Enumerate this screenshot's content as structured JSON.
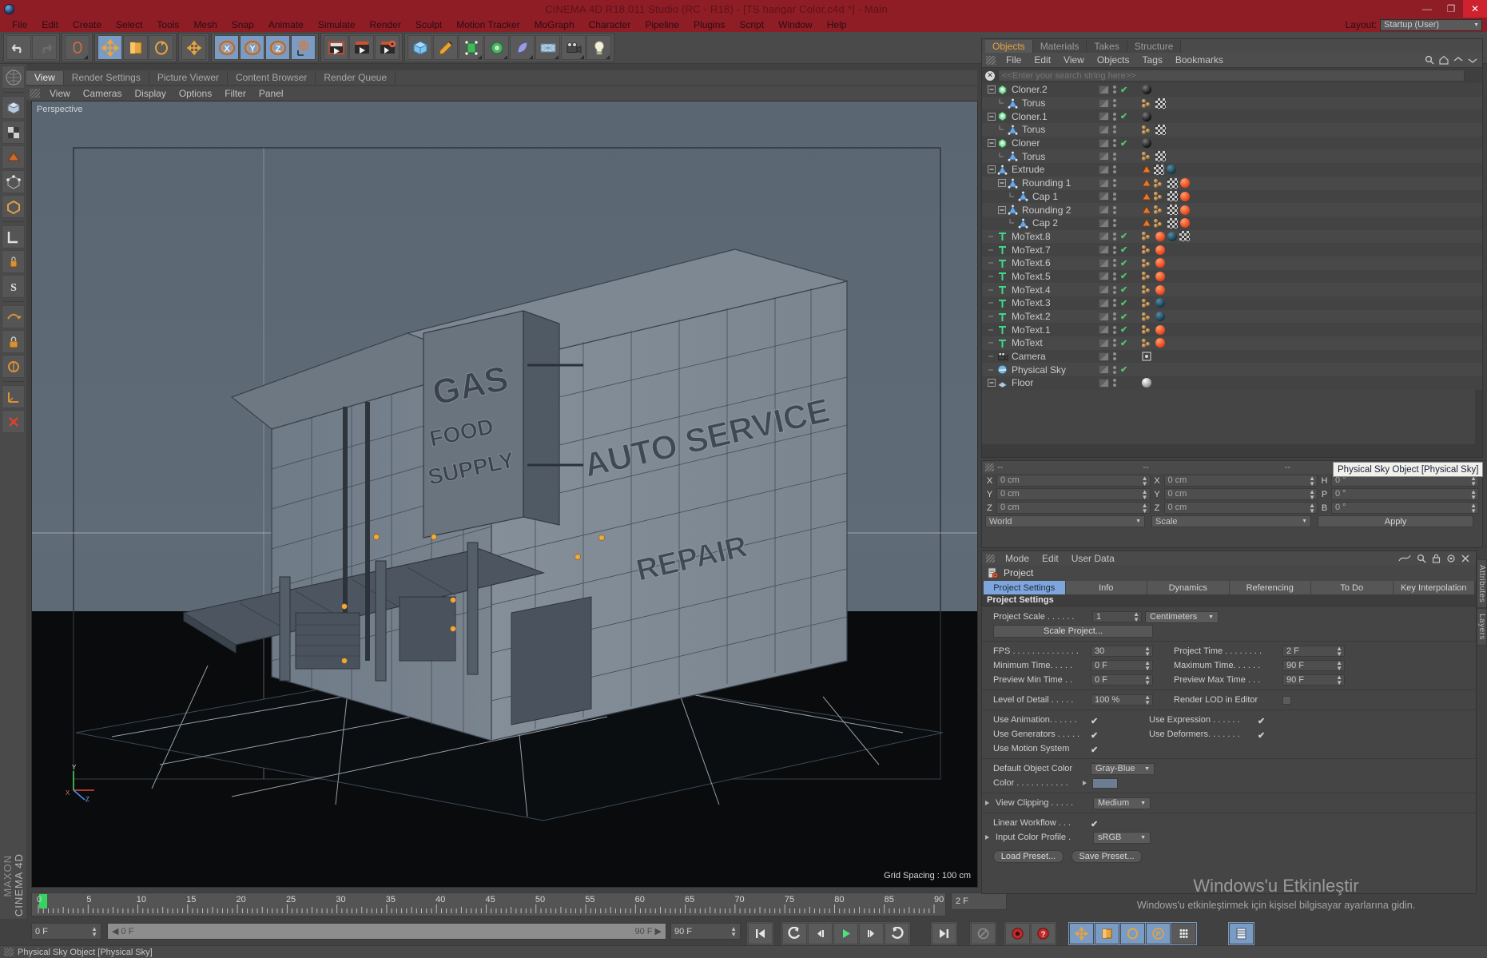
{
  "window": {
    "title": "CINEMA 4D R18.011 Studio (RC - R18) - [TS hangar Color.c4d *] - Main",
    "minimize": "—",
    "maximize": "❐",
    "close": "✕"
  },
  "menubar": {
    "items": [
      "File",
      "Edit",
      "Create",
      "Select",
      "Tools",
      "Mesh",
      "Snap",
      "Animate",
      "Simulate",
      "Render",
      "Sculpt",
      "Motion Tracker",
      "MoGraph",
      "Character",
      "Pipeline",
      "Plugins",
      "Script",
      "Window",
      "Help"
    ],
    "layout_label": "Layout:",
    "layout_value": "Startup (User)"
  },
  "viewport": {
    "tabs": [
      "View",
      "Render Settings",
      "Picture Viewer",
      "Content Browser",
      "Render Queue"
    ],
    "active_tab": "View",
    "menus": [
      "View",
      "Cameras",
      "Display",
      "Options",
      "Filter",
      "Panel"
    ],
    "perspective_label": "Perspective",
    "grid_spacing": "Grid Spacing : 100 cm",
    "signage": [
      "GAS",
      "FOOD SUPPLY",
      "AUTO SERVICE",
      "REPAIR"
    ],
    "axis": {
      "x": "X",
      "y": "Y",
      "z": "Z"
    }
  },
  "object_manager": {
    "tabs": [
      "Objects",
      "Materials",
      "Takes",
      "Structure"
    ],
    "active_tab": "Objects",
    "menus": [
      "File",
      "Edit",
      "View",
      "Objects",
      "Tags",
      "Bookmarks"
    ],
    "search_placeholder": "<<Enter your search string here>>",
    "rows": [
      {
        "name": "Cloner.2",
        "icon": "cloner-icon",
        "depth": 0,
        "expander": "minus",
        "check": true,
        "mat": [
          "sph-k"
        ]
      },
      {
        "name": "Torus",
        "icon": "torus-icon",
        "depth": 1,
        "expander": "none",
        "check": false,
        "mat": [
          "dotpair",
          "checker"
        ]
      },
      {
        "name": "Cloner.1",
        "icon": "cloner-icon",
        "depth": 0,
        "expander": "minus",
        "check": true,
        "mat": [
          "sph-k"
        ]
      },
      {
        "name": "Torus",
        "icon": "torus-icon",
        "depth": 1,
        "expander": "none",
        "check": false,
        "mat": [
          "dotpair",
          "checker"
        ]
      },
      {
        "name": "Cloner",
        "icon": "cloner-icon",
        "depth": 0,
        "expander": "minus",
        "check": true,
        "mat": [
          "sph-k"
        ]
      },
      {
        "name": "Torus",
        "icon": "torus-icon",
        "depth": 1,
        "expander": "none",
        "check": false,
        "mat": [
          "dotpair",
          "checker"
        ]
      },
      {
        "name": "Extrude",
        "icon": "extrude-icon",
        "depth": 0,
        "expander": "minus",
        "check": false,
        "mat": [
          "tri-o",
          "checker",
          "sph-b"
        ]
      },
      {
        "name": "Rounding 1",
        "icon": "extrude-icon",
        "depth": 1,
        "expander": "minus",
        "check": false,
        "mat": [
          "tri-o",
          "dotpair",
          "checker",
          "sph-o"
        ]
      },
      {
        "name": "Cap 1",
        "icon": "extrude-icon",
        "depth": 2,
        "expander": "none",
        "check": false,
        "mat": [
          "tri-o",
          "dotpair",
          "checker",
          "sph-o"
        ]
      },
      {
        "name": "Rounding 2",
        "icon": "extrude-icon",
        "depth": 1,
        "expander": "minus",
        "check": false,
        "mat": [
          "tri-o",
          "dotpair",
          "checker",
          "sph-o"
        ]
      },
      {
        "name": "Cap 2",
        "icon": "extrude-icon",
        "depth": 2,
        "expander": "none",
        "check": false,
        "mat": [
          "tri-o",
          "dotpair",
          "checker",
          "sph-o"
        ]
      },
      {
        "name": "MoText.8",
        "icon": "motext-icon",
        "depth": 0,
        "expander": "dash",
        "check": true,
        "mat": [
          "dotpair",
          "sph-o",
          "sph-b",
          "checker"
        ]
      },
      {
        "name": "MoText.7",
        "icon": "motext-icon",
        "depth": 0,
        "expander": "dash",
        "check": true,
        "mat": [
          "dotpair",
          "sph-o"
        ]
      },
      {
        "name": "MoText.6",
        "icon": "motext-icon",
        "depth": 0,
        "expander": "dash",
        "check": true,
        "mat": [
          "dotpair",
          "sph-o"
        ]
      },
      {
        "name": "MoText.5",
        "icon": "motext-icon",
        "depth": 0,
        "expander": "dash",
        "check": true,
        "mat": [
          "dotpair",
          "sph-o"
        ]
      },
      {
        "name": "MoText.4",
        "icon": "motext-icon",
        "depth": 0,
        "expander": "dash",
        "check": true,
        "mat": [
          "dotpair",
          "sph-o"
        ]
      },
      {
        "name": "MoText.3",
        "icon": "motext-icon",
        "depth": 0,
        "expander": "dash",
        "check": true,
        "mat": [
          "dotpair",
          "sph-b"
        ]
      },
      {
        "name": "MoText.2",
        "icon": "motext-icon",
        "depth": 0,
        "expander": "dash",
        "check": true,
        "mat": [
          "dotpair",
          "sph-b"
        ]
      },
      {
        "name": "MoText.1",
        "icon": "motext-icon",
        "depth": 0,
        "expander": "dash",
        "check": true,
        "mat": [
          "dotpair",
          "sph-o"
        ]
      },
      {
        "name": "MoText",
        "icon": "motext-icon",
        "depth": 0,
        "expander": "dash",
        "check": true,
        "mat": [
          "dotpair",
          "sph-o"
        ]
      },
      {
        "name": "Camera",
        "icon": "camera-icon",
        "depth": 0,
        "expander": "dash",
        "check": false,
        "mat": [
          "target"
        ]
      },
      {
        "name": "Physical Sky",
        "icon": "sky-icon",
        "depth": 0,
        "expander": "dash",
        "check": true,
        "mat": []
      },
      {
        "name": "Floor",
        "icon": "floor-icon",
        "depth": 0,
        "expander": "minus",
        "check": false,
        "mat": [
          "sph-w"
        ]
      }
    ]
  },
  "coordinates": {
    "header_left": "--",
    "header_right": "--",
    "position": {
      "x_label": "X",
      "y_label": "Y",
      "z_label": "Z",
      "x": "0 cm",
      "y": "0 cm",
      "z": "0 cm"
    },
    "size": {
      "x_label": "X",
      "y_label": "Y",
      "z_label": "Z",
      "x": "0 cm",
      "y": "0 cm",
      "z": "0 cm"
    },
    "rotation": {
      "h_label": "H",
      "p_label": "P",
      "b_label": "B",
      "h": "0 °",
      "p": "0 °",
      "b": "0 °"
    },
    "coord_system": "World",
    "mode": "Scale",
    "apply_label": "Apply"
  },
  "attributes": {
    "menus": [
      "Mode",
      "Edit",
      "User Data"
    ],
    "object_title": "Project",
    "tabs": [
      "Project Settings",
      "Info",
      "Dynamics",
      "Referencing",
      "To Do",
      "Key Interpolation"
    ],
    "active_tab": "Project Settings",
    "section_title": "Project Settings",
    "fields": {
      "project_scale_label": "Project Scale . . . . . .",
      "project_scale_value": "1",
      "project_scale_unit": "Centimeters",
      "scale_project_btn": "Scale Project...",
      "fps_label": "FPS . . . . . . . . . . . . . .",
      "fps_value": "30",
      "project_time_label": "Project Time . . . . . . . .",
      "project_time_value": "2 F",
      "min_time_label": "Minimum Time. . . . .",
      "min_time_value": "0 F",
      "max_time_label": "Maximum Time. . . . . .",
      "max_time_value": "90 F",
      "prev_min_label": "Preview Min Time . .",
      "prev_min_value": "0 F",
      "prev_max_label": "Preview Max Time . . .",
      "prev_max_value": "90 F",
      "lod_label": "Level of Detail . . . . .",
      "lod_value": "100 %",
      "render_lod_label": "Render LOD in Editor",
      "use_animation_label": "Use Animation. . . . . .",
      "use_expression_label": "Use Expression . . . . . .",
      "use_generators_label": "Use Generators . . . . .",
      "use_deformers_label": "Use Deformers. . . . . . .",
      "use_motion_label": "Use Motion System",
      "default_color_label": "Default Object Color",
      "default_color_value": "Gray-Blue",
      "color_label": "Color . . . . . . . . . . .",
      "color_swatch": "#6c7d92",
      "view_clipping_label": "View Clipping . . . . .",
      "view_clipping_value": "Medium",
      "linear_workflow_label": "Linear Workflow . . .",
      "input_profile_label": "Input Color Profile .",
      "input_profile_value": "sRGB",
      "load_preset_btn": "Load Preset...",
      "save_preset_btn": "Save Preset..."
    }
  },
  "edge_tabs": [
    "Attributes",
    "Layers"
  ],
  "timeline": {
    "ticks": [
      "0",
      "5",
      "10",
      "15",
      "20",
      "25",
      "30",
      "35",
      "40",
      "45",
      "50",
      "55",
      "60",
      "65",
      "70",
      "75",
      "80",
      "85",
      "90"
    ],
    "current_marker": "2",
    "frame_field": "2 F",
    "current_frame": "0 F",
    "range_start": "0 F",
    "range_end": "90 F",
    "end_field": "90 F"
  },
  "statusbar": {
    "text": "Physical Sky Object [Physical Sky]"
  },
  "tooltip": {
    "text": "Physical Sky Object [Physical Sky]"
  },
  "watermark": {
    "line1": "Windows'u Etkinleştir",
    "line2": "Windows'u etkinleştirmek için kişisel bilgisayar ayarlarına gidin."
  },
  "branding": {
    "maxon": "MAXON",
    "c4d": "CINEMA 4D"
  },
  "colors": {
    "titlebar": "#8e1d26",
    "accent_tab": "#e8a33d",
    "selected_tab": "#7ea6dd",
    "check_green": "#55c46a",
    "close_red": "#d0212e"
  }
}
